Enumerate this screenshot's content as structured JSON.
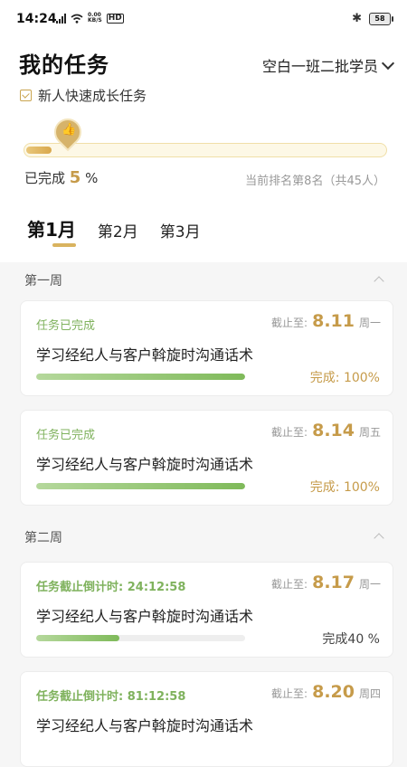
{
  "status_bar": {
    "time": "14:24",
    "network": "4G",
    "speed_value": "0.00",
    "speed_unit": "KB/S",
    "hd": "HD",
    "battery": "58"
  },
  "header": {
    "title": "我的任务",
    "class_select": "空白一班二批学员",
    "subtitle": "新人快速成长任务"
  },
  "overall_progress": {
    "percent": 5,
    "done_prefix": "已完成",
    "done_value": "5",
    "done_suffix": "%",
    "rank_text": "当前排名第8名（共45人）"
  },
  "colors": {
    "accent_gold": "#c69b4a",
    "status_green": "#7fb25d"
  },
  "month_tabs": [
    {
      "label": "第1月",
      "active": true
    },
    {
      "label": "第2月",
      "active": false
    },
    {
      "label": "第3月",
      "active": false
    }
  ],
  "weeks": [
    {
      "label": "第一周"
    },
    {
      "label": "第二周"
    }
  ],
  "tasks": [
    {
      "status": "任务已完成",
      "deadline_label": "截止至:",
      "date": "8.11",
      "weekday": "周一",
      "title": "学习经纪人与客户斡旋时沟通话术",
      "progress": 1.0,
      "complete_text": "完成: 100%"
    },
    {
      "status": "任务已完成",
      "deadline_label": "截止至:",
      "date": "8.14",
      "weekday": "周五",
      "title": "学习经纪人与客户斡旋时沟通话术",
      "progress": 1.0,
      "complete_text": "完成: 100%"
    },
    {
      "status": "任务截止倒计时: 24:12:58",
      "deadline_label": "截止至:",
      "date": "8.17",
      "weekday": "周一",
      "title": "学习经纪人与客户斡旋时沟通话术",
      "progress": 0.4,
      "complete_text": "完成40 %"
    },
    {
      "status": "任务截止倒计时: 81:12:58",
      "deadline_label": "截止至:",
      "date": "8.20",
      "weekday": "周四",
      "title": "学习经纪人与客户斡旋时沟通话术",
      "progress": 0.0,
      "complete_text": ""
    }
  ]
}
